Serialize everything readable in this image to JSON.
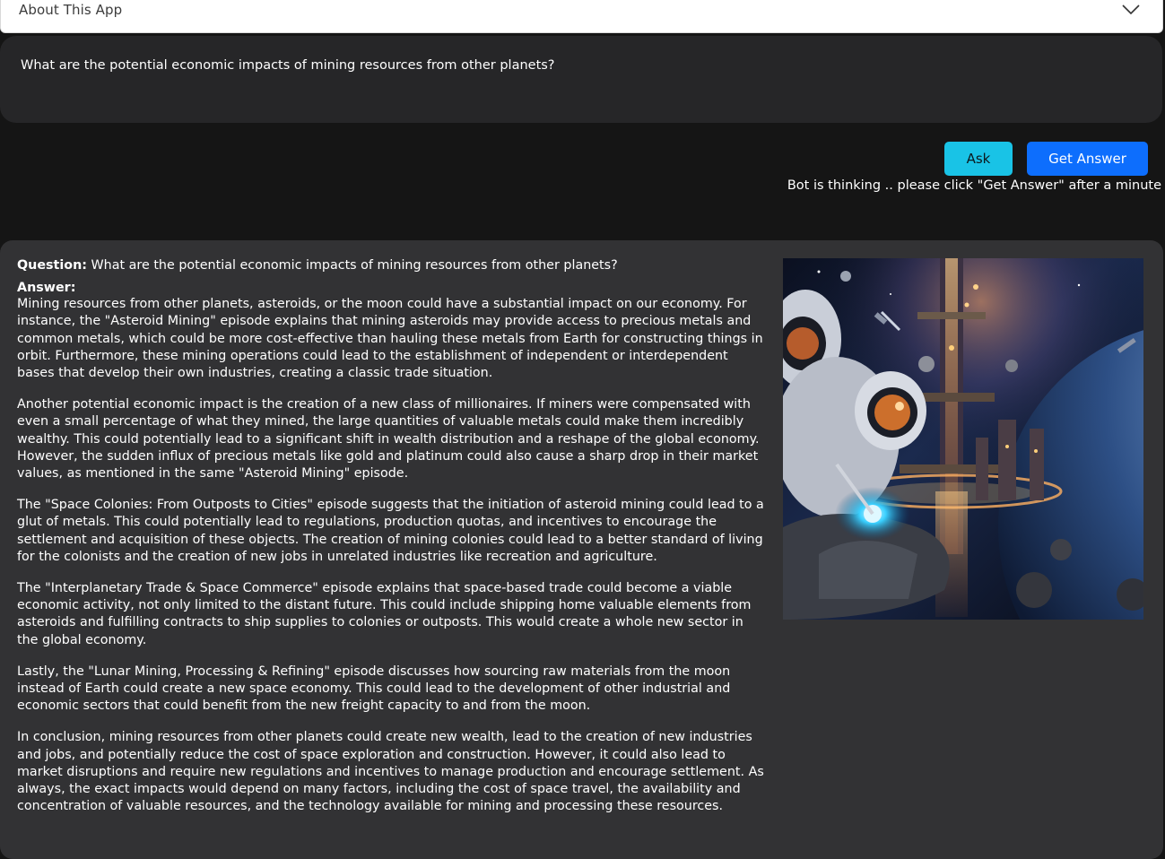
{
  "about": {
    "title": "About This App",
    "chevron_icon": "chevron-down-icon"
  },
  "question_input": {
    "value": "What are the potential economic impacts of mining resources from other planets?"
  },
  "buttons": {
    "ask": "Ask",
    "get_answer": "Get Answer",
    "ask_color": "#19c3e6",
    "get_answer_color": "#0d6efd"
  },
  "status": "Bot is thinking .. please click \"Get Answer\" after a minute",
  "result": {
    "question_label": "Question:",
    "question_text": " What are the potential economic impacts of mining resources from other planets?",
    "answer_label": "Answer:",
    "paragraphs": [
      "Mining resources from other planets, asteroids, or the moon could have a substantial impact on our economy. For instance, the \"Asteroid Mining\" episode explains that mining asteroids may provide access to precious metals and common metals, which could be more cost-effective than hauling these metals from Earth for constructing things in orbit. Furthermore, these mining operations could lead to the establishment of independent or interdependent bases that develop their own industries, creating a classic trade situation.",
      "Another potential economic impact is the creation of a new class of millionaires. If miners were compensated with even a small percentage of what they mined, the large quantities of valuable metals could make them incredibly wealthy. This could potentially lead to a significant shift in wealth distribution and a reshape of the global economy. However, the sudden influx of precious metals like gold and platinum could also cause a sharp drop in their market values, as mentioned in the same \"Asteroid Mining\" episode.",
      "The \"Space Colonies: From Outposts to Cities\" episode suggests that the initiation of asteroid mining could lead to a glut of metals. This could potentially lead to regulations, production quotas, and incentives to encourage the settlement and acquisition of these objects. The creation of mining colonies could lead to a better standard of living for the colonists and the creation of new jobs in unrelated industries like recreation and agriculture.",
      "The \"Interplanetary Trade & Space Commerce\" episode explains that space-based trade could become a viable economic activity, not only limited to the distant future. This could include shipping home valuable elements from asteroids and fulfilling contracts to ship supplies to colonies or outposts. This would create a whole new sector in the global economy.",
      "Lastly, the \"Lunar Mining, Processing & Refining\" episode discusses how sourcing raw materials from the moon instead of Earth could create a new space economy. This could lead to the development of other industrial and economic sectors that could benefit from the new freight capacity to and from the moon.",
      "In conclusion, mining resources from other planets could create new wealth, lead to the creation of new industries and jobs, and potentially reduce the cost of space exploration and construction. However, it could also lead to market disruptions and require new regulations and incentives to manage production and encourage settlement. As always, the exact impacts would depend on many factors, including the cost of space travel, the availability and concentration of valuable resources, and the technology available for mining and processing these resources."
    ]
  }
}
